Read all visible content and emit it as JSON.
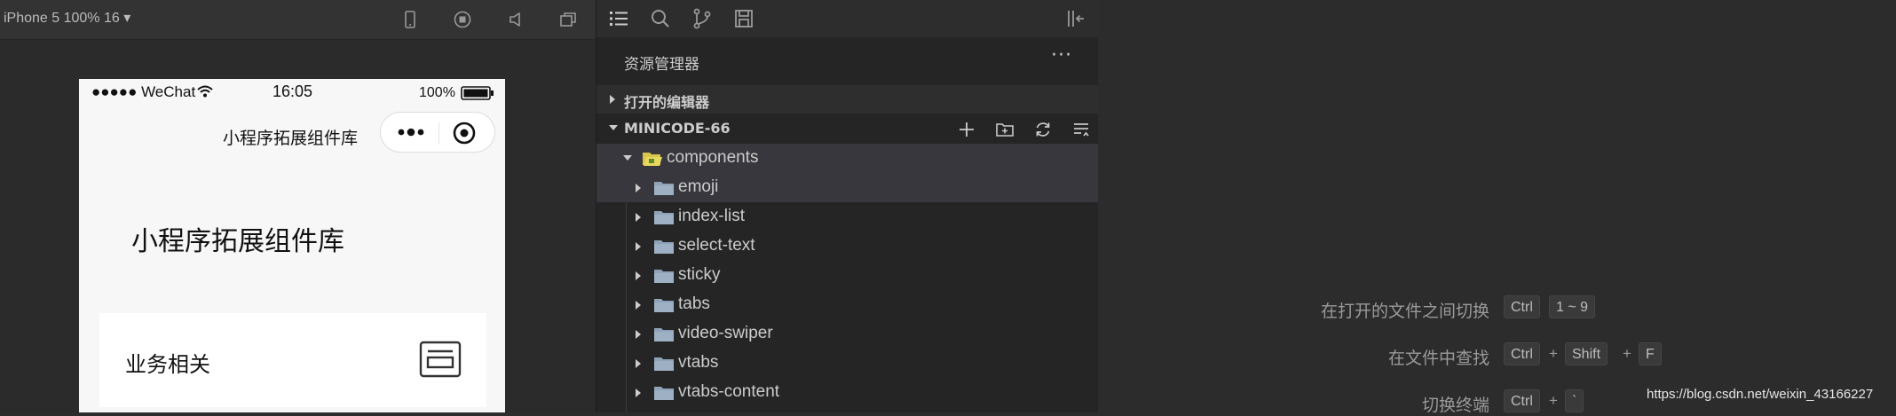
{
  "simulator": {
    "device_label": "iPhone 5 100% 16 ▾",
    "status": {
      "carrier": "●●●●● WeChat",
      "time": "16:05",
      "battery": "100%"
    },
    "navbar_title": "小程序拓展组件库",
    "capsule_more": "•••",
    "page_title": "小程序拓展组件库",
    "card_label": "业务相关"
  },
  "explorer": {
    "title": "资源管理器",
    "more": "···",
    "open_editors_label": "打开的编辑器",
    "project_label": "MINICODE-66",
    "tree": [
      {
        "name": "components",
        "expanded": true
      },
      {
        "name": "emoji"
      },
      {
        "name": "index-list"
      },
      {
        "name": "select-text"
      },
      {
        "name": "sticky"
      },
      {
        "name": "tabs"
      },
      {
        "name": "video-swiper"
      },
      {
        "name": "vtabs"
      },
      {
        "name": "vtabs-content"
      }
    ]
  },
  "shortcuts": [
    {
      "label": "在打开的文件之间切换",
      "keys": [
        "Ctrl",
        "1 ~ 9"
      ]
    },
    {
      "label": "在文件中查找",
      "keys": [
        "Ctrl",
        "+",
        "Shift",
        "+",
        "F"
      ]
    },
    {
      "label": "切换终端",
      "keys": [
        "Ctrl",
        "+",
        "`"
      ]
    }
  ],
  "watermark": "https://blog.csdn.net/weixin_43166227",
  "colors": {
    "folder": "#8fa3b8",
    "folder_open": "#d8c64a",
    "selected_row": "#37373d"
  }
}
